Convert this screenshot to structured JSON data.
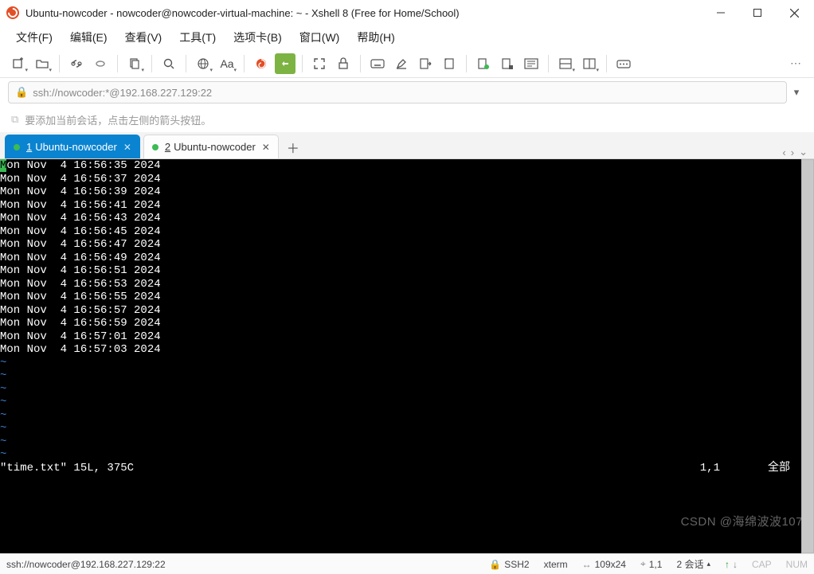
{
  "titlebar": {
    "title": "Ubuntu-nowcoder - nowcoder@nowcoder-virtual-machine: ~ - Xshell 8 (Free for Home/School)"
  },
  "menus": [
    "文件(F)",
    "编辑(E)",
    "查看(V)",
    "工具(T)",
    "选项卡(B)",
    "窗口(W)",
    "帮助(H)"
  ],
  "toolbar_font_label": "Aa",
  "address": {
    "url": "ssh://nowcoder:*@192.168.227.129:22"
  },
  "hint": {
    "text": "要添加当前会话，点击左侧的箭头按钮。"
  },
  "tabs": [
    {
      "num": "1",
      "label": "Ubuntu-nowcoder",
      "active": true
    },
    {
      "num": "2",
      "label": "Ubuntu-nowcoder",
      "active": false
    }
  ],
  "terminal": {
    "lines": [
      "Mon Nov  4 16:56:35 2024",
      "Mon Nov  4 16:56:37 2024",
      "Mon Nov  4 16:56:39 2024",
      "Mon Nov  4 16:56:41 2024",
      "Mon Nov  4 16:56:43 2024",
      "Mon Nov  4 16:56:45 2024",
      "Mon Nov  4 16:56:47 2024",
      "Mon Nov  4 16:56:49 2024",
      "Mon Nov  4 16:56:51 2024",
      "Mon Nov  4 16:56:53 2024",
      "Mon Nov  4 16:56:55 2024",
      "Mon Nov  4 16:56:57 2024",
      "Mon Nov  4 16:56:59 2024",
      "Mon Nov  4 16:57:01 2024",
      "Mon Nov  4 16:57:03 2024"
    ],
    "tilde_rows": 8,
    "status_left": "\"time.txt\" 15L, 375C",
    "status_pos": "1,1",
    "status_scroll": "全部"
  },
  "statusbar": {
    "conn": "ssh://nowcoder@192.168.227.129:22",
    "proto": "SSH2",
    "term": "xterm",
    "size": "109x24",
    "pos": "1,1",
    "sessions": "2 会话",
    "cap": "CAP",
    "num": "NUM"
  },
  "watermark": "CSDN @海绵波波107"
}
